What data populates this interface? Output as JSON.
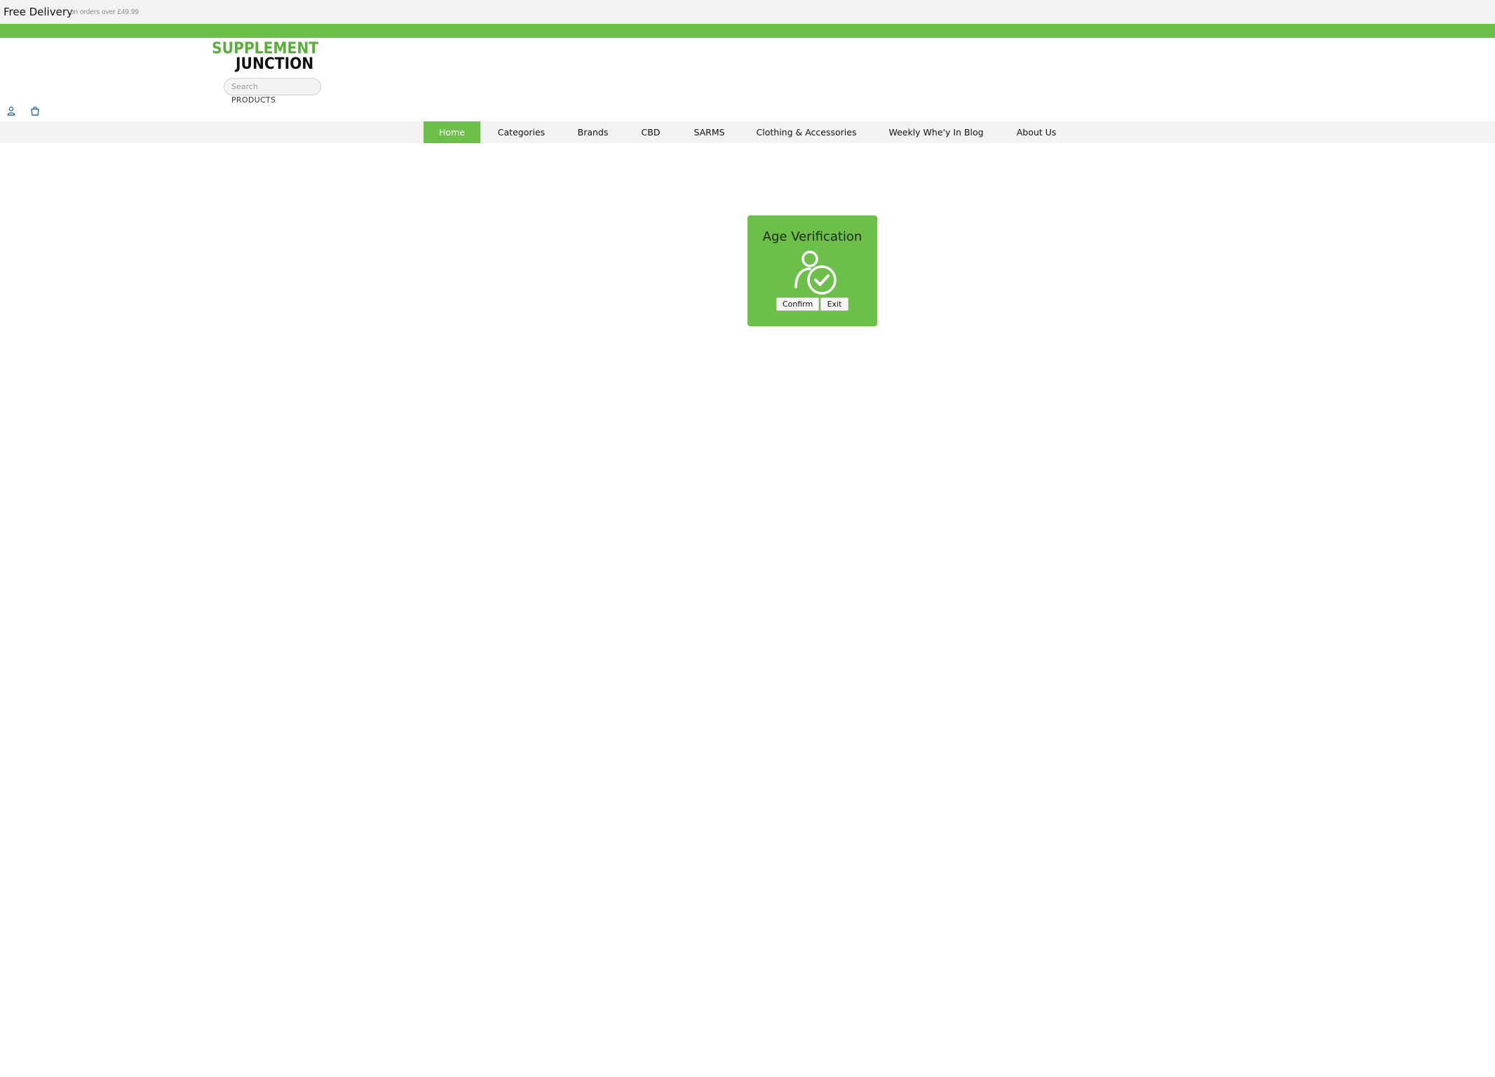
{
  "topbar": {
    "free_delivery": "Free Delivery",
    "free_delivery_sub": "on orders over £49.99"
  },
  "header": {
    "logo_line1": "SUPPLEMENT",
    "logo_line2": "JUNCTION",
    "search_placeholder": "Search",
    "products_label": "PRODUCTS",
    "account_icon": "user-icon",
    "cart_icon": "shopping-bag-icon"
  },
  "nav": {
    "items": [
      {
        "label": "Home",
        "active": true
      },
      {
        "label": "Categories"
      },
      {
        "label": "Brands"
      },
      {
        "label": "CBD"
      },
      {
        "label": "SARMS"
      },
      {
        "label": "Clothing & Accessories"
      },
      {
        "label": "Weekly Whe'y In Blog"
      },
      {
        "label": "About Us"
      }
    ]
  },
  "age_modal": {
    "title": "Age Verification",
    "icon": "user-check-icon",
    "confirm_label": "Confirm",
    "exit_label": "Exit"
  },
  "colors": {
    "brand_green": "#6cc04a",
    "topbar_bg": "#f4f2f0",
    "icon_blue": "#2c6e9e"
  }
}
